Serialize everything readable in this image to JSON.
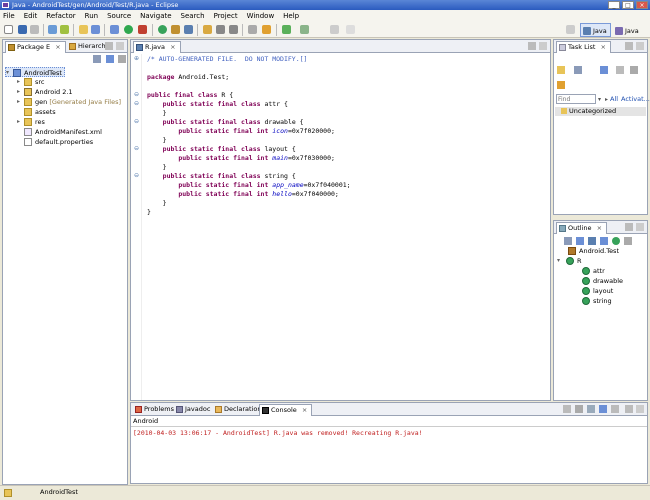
{
  "window": {
    "title": "Java - AndroidTest/gen/Android/Test/R.java - Eclipse",
    "min_btn": "_",
    "max_btn": "□",
    "close_btn": "×"
  },
  "menu": [
    "File",
    "Edit",
    "Refactor",
    "Run",
    "Source",
    "Navigate",
    "Search",
    "Project",
    "Window",
    "Help"
  ],
  "perspectives": {
    "java": "Java",
    "java_ee": "Java EE"
  },
  "package_explorer": {
    "tabs": {
      "package": "Package E",
      "hierarchy": "Hierarchy"
    },
    "tree": [
      {
        "label": "AndroidTest",
        "indent": 0,
        "icon": "project-icon"
      },
      {
        "label": "src",
        "indent": 1,
        "icon": "source-folder-icon"
      },
      {
        "label": "Android 2.1",
        "indent": 1,
        "icon": "library-icon"
      },
      {
        "label": "gen",
        "suffix": " [Generated Java Files]",
        "indent": 1,
        "icon": "source-folder-icon"
      },
      {
        "label": "assets",
        "indent": 1,
        "icon": "folder-icon"
      },
      {
        "label": "res",
        "indent": 1,
        "icon": "folder-icon"
      },
      {
        "label": "AndroidManifest.xml",
        "indent": 1,
        "icon": "xml-file-icon"
      },
      {
        "label": "default.properties",
        "indent": 1,
        "icon": "file-icon"
      }
    ]
  },
  "editor": {
    "tab_label": "R.java",
    "lines": [
      {
        "text": "/* AUTO-GENERATED FILE.  DO NOT MODIFY.[]",
        "type": "comment"
      },
      {
        "text": "",
        "type": "blank"
      },
      {
        "text": "package Android.Test;",
        "type": "code"
      },
      {
        "text": "",
        "type": "blank"
      },
      {
        "text": "public final class R {",
        "type": "code"
      },
      {
        "text": "    public static final class attr {",
        "type": "code"
      },
      {
        "text": "    }",
        "type": "code"
      },
      {
        "text": "    public static final class drawable {",
        "type": "code"
      },
      {
        "text": "        public static final int icon=0x7f020000;",
        "type": "code"
      },
      {
        "text": "    }",
        "type": "code"
      },
      {
        "text": "    public static final class layout {",
        "type": "code"
      },
      {
        "text": "        public static final int main=0x7f030000;",
        "type": "code"
      },
      {
        "text": "    }",
        "type": "code"
      },
      {
        "text": "    public static final class string {",
        "type": "code"
      },
      {
        "text": "        public static final int app_name=0x7f040001;",
        "type": "code"
      },
      {
        "text": "        public static final int hello=0x7f040000;",
        "type": "code"
      },
      {
        "text": "    }",
        "type": "code"
      },
      {
        "text": "}",
        "type": "code"
      }
    ]
  },
  "task_list": {
    "tab_label": "Task List",
    "find_placeholder": "Find",
    "all_label": "All",
    "activate_label": "Activat...",
    "category": "Uncategorized"
  },
  "outline": {
    "tab_label": "Outline",
    "items": [
      {
        "label": "Android.Test",
        "indent": 0,
        "icon": "package-icon"
      },
      {
        "label": "R",
        "indent": 0,
        "icon": "class-icon"
      },
      {
        "label": "attr",
        "indent": 1,
        "icon": "class-icon"
      },
      {
        "label": "drawable",
        "indent": 1,
        "icon": "class-icon"
      },
      {
        "label": "layout",
        "indent": 1,
        "icon": "class-icon"
      },
      {
        "label": "string",
        "indent": 1,
        "icon": "class-icon"
      }
    ]
  },
  "bottom": {
    "tabs": {
      "problems": "Problems",
      "javadoc": "Javadoc",
      "declaration": "Declaration",
      "console": "Console"
    },
    "console_header": "Android",
    "console_text": "[2010-04-03 13:06:17 - AndroidTest] R.java was removed! Recreating R.java!"
  },
  "status": {
    "text": "AndroidTest"
  },
  "colors": {
    "console_text": "#C02020",
    "keyword": "#7F0055",
    "comment": "#3F5FBF",
    "field": "#0000C0"
  }
}
